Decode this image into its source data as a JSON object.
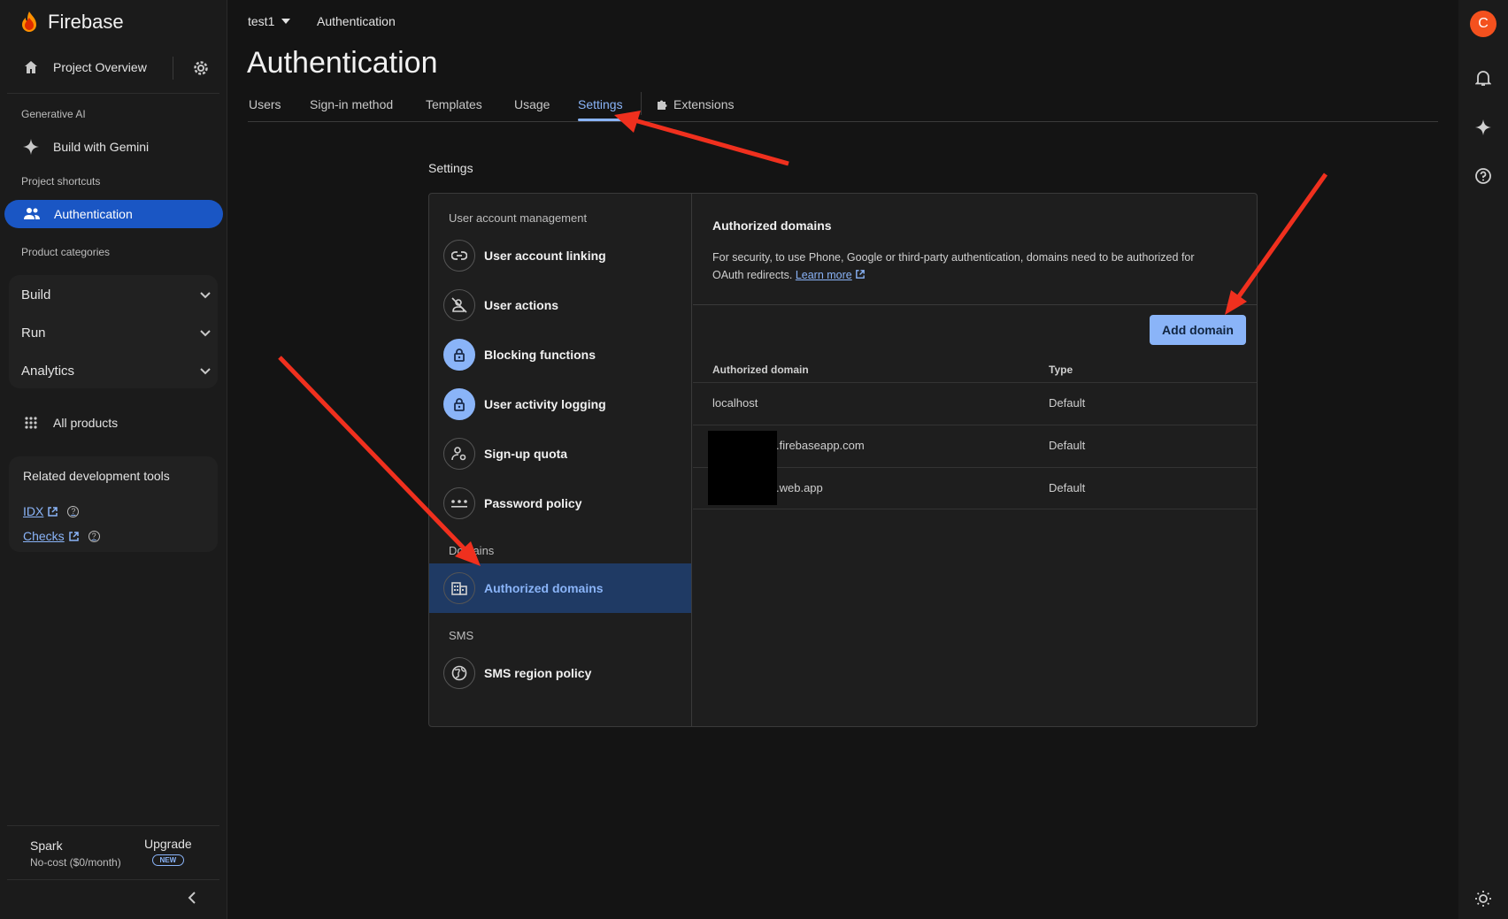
{
  "brand": {
    "name": "Firebase"
  },
  "sidebar": {
    "project_overview": "Project Overview",
    "section_genai": "Generative AI",
    "build_with_gemini": "Build with Gemini",
    "section_shortcuts": "Project shortcuts",
    "authentication": "Authentication",
    "section_categories": "Product categories",
    "categories": [
      {
        "label": "Build"
      },
      {
        "label": "Run"
      },
      {
        "label": "Analytics"
      }
    ],
    "all_products": "All products",
    "tools_title": "Related development tools",
    "tools": [
      {
        "label": "IDX"
      },
      {
        "label": "Checks"
      }
    ],
    "plan_name": "Spark",
    "plan_cost": "No-cost ($0/month)",
    "upgrade_label": "Upgrade",
    "new_badge": "NEW"
  },
  "rail": {
    "avatar_letter": "C"
  },
  "header": {
    "project": "test1",
    "breadcrumb": "Authentication",
    "title": "Authentication"
  },
  "tabs": [
    {
      "label": "Users"
    },
    {
      "label": "Sign-in method"
    },
    {
      "label": "Templates"
    },
    {
      "label": "Usage"
    },
    {
      "label": "Settings",
      "active": true
    },
    {
      "label": "Extensions"
    }
  ],
  "settings": {
    "label": "Settings",
    "nav": {
      "section_user": "User account management",
      "items_user": [
        {
          "label": "User account linking",
          "icon": "link-icon"
        },
        {
          "label": "User actions",
          "icon": "person-off-icon"
        },
        {
          "label": "Blocking functions",
          "icon": "lock-icon"
        },
        {
          "label": "User activity logging",
          "icon": "lock-icon"
        },
        {
          "label": "Sign-up quota",
          "icon": "person-gear-icon"
        },
        {
          "label": "Password policy",
          "icon": "password-icon"
        }
      ],
      "section_domains": "Domains",
      "authorized_domains": "Authorized domains",
      "section_sms": "SMS",
      "sms_region_policy": "SMS region policy"
    },
    "panel": {
      "title": "Authorized domains",
      "description": "For security, to use Phone, Google or third-party authentication, domains need to be authorized for OAuth redirects.",
      "learn_more": "Learn more",
      "add_button": "Add domain",
      "col_domain": "Authorized domain",
      "col_type": "Type",
      "rows": [
        {
          "domain": "localhost",
          "type": "Default"
        },
        {
          "domain": ".firebaseapp.com",
          "type": "Default"
        },
        {
          "domain": ".web.app",
          "type": "Default"
        }
      ]
    }
  },
  "colors": {
    "accent": "#8ab4f8",
    "active_nav": "#1a56c4",
    "annotation": "#f0301e",
    "avatar": "#f4511e"
  }
}
